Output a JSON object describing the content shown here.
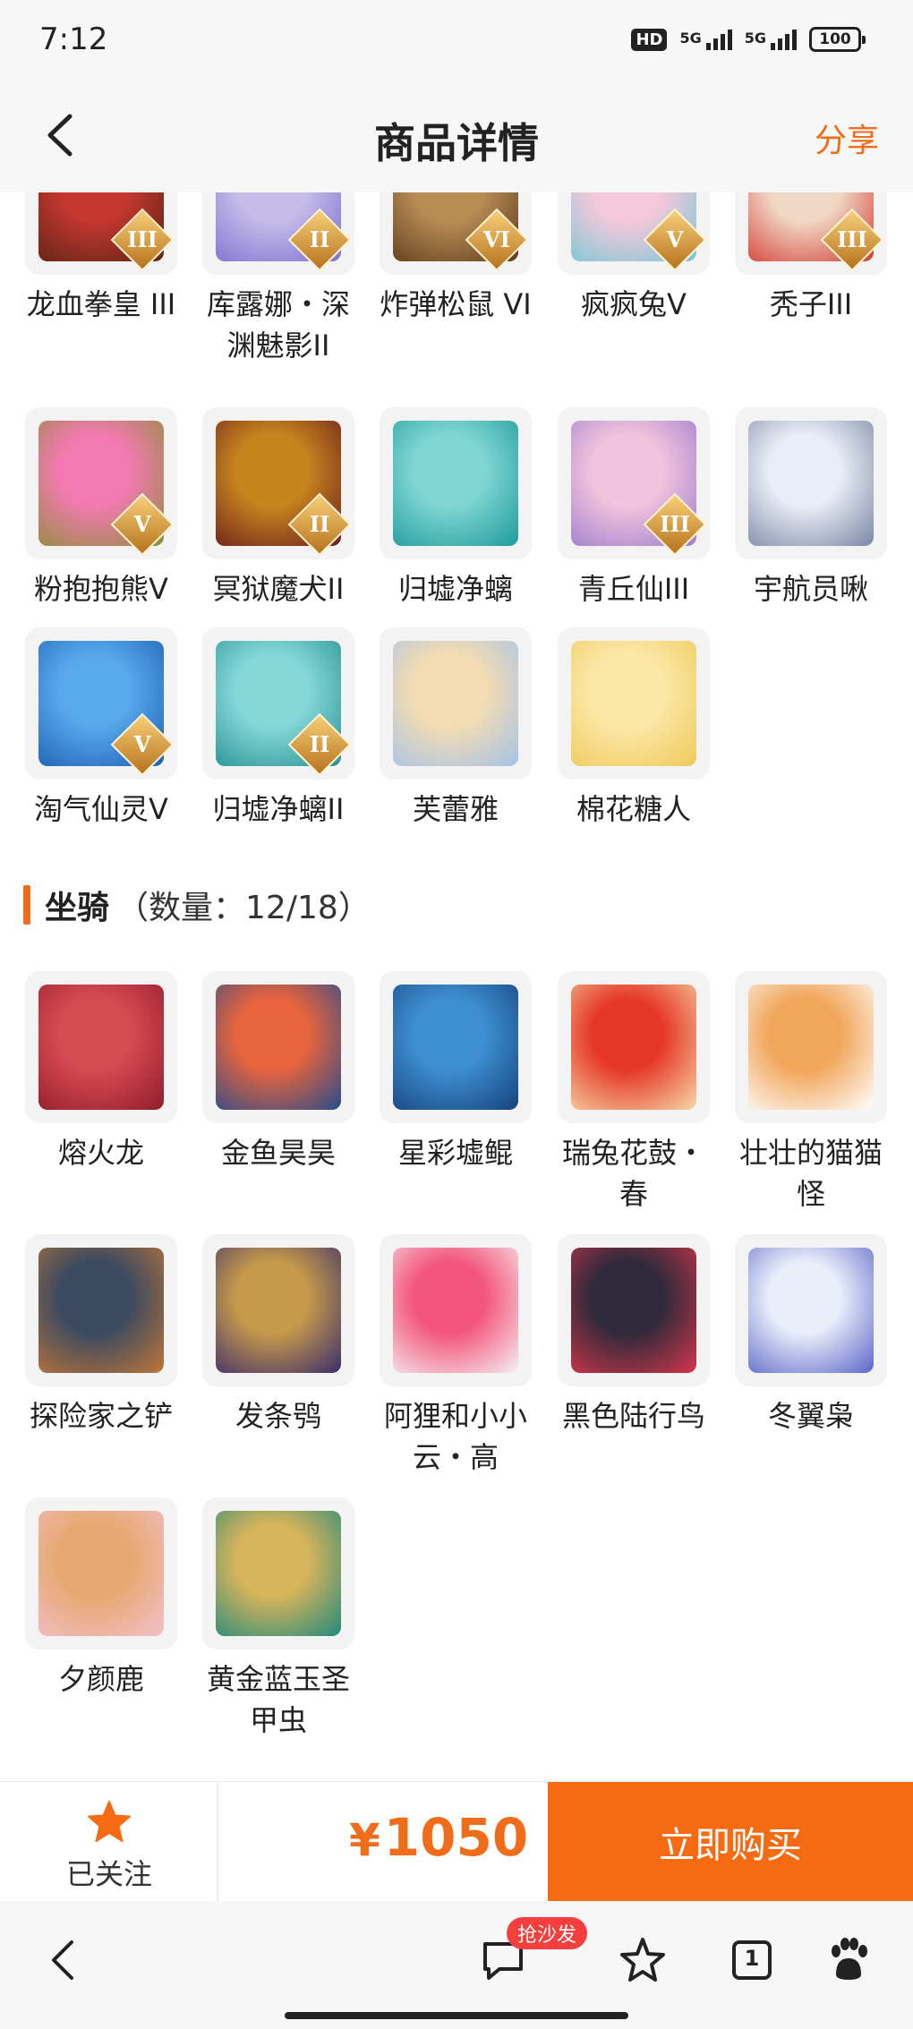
{
  "status_bar": {
    "time": "7:12",
    "hd_label": "HD",
    "network1": "5G",
    "network2": "5G",
    "battery": "100"
  },
  "nav": {
    "title": "商品详情",
    "share_label": "分享"
  },
  "skins": [
    {
      "name": "龙血拳皇 III",
      "level": "III",
      "colors": [
        "#c3372f",
        "#5a2414"
      ]
    },
    {
      "name": "库露娜・深渊魅影II",
      "level": "II",
      "colors": [
        "#c5bce8",
        "#7c6ed1"
      ]
    },
    {
      "name": "炸弹松鼠 VI",
      "level": "VI",
      "colors": [
        "#b98c55",
        "#5b3a1c"
      ]
    },
    {
      "name": "疯疯兔V",
      "level": "V",
      "colors": [
        "#f4c8d9",
        "#77c7d8"
      ]
    },
    {
      "name": "秃子III",
      "level": "III",
      "colors": [
        "#f0d7c4",
        "#d23a31"
      ]
    },
    {
      "name": "粉抱抱熊Ⅴ",
      "level": "V",
      "colors": [
        "#f27ab0",
        "#8f8e3a"
      ]
    },
    {
      "name": "冥狱魔犬II",
      "level": "II",
      "colors": [
        "#c7851e",
        "#6a1b1c"
      ]
    },
    {
      "name": "归墟净螭",
      "level": "",
      "colors": [
        "#7fd6d2",
        "#1e9a9c"
      ]
    },
    {
      "name": "青丘仙III",
      "level": "III",
      "colors": [
        "#f1c3dc",
        "#9b7ccf"
      ]
    },
    {
      "name": "宇航员啾",
      "level": "",
      "colors": [
        "#e9edf5",
        "#7b86a6"
      ]
    },
    {
      "name": "淘气仙灵V",
      "level": "V",
      "colors": [
        "#58a8ec",
        "#1a5fb3"
      ]
    },
    {
      "name": "归墟净螭II",
      "level": "II",
      "colors": [
        "#86d8d8",
        "#268f92"
      ]
    },
    {
      "name": "芙蕾雅",
      "level": "",
      "colors": [
        "#f4dcb2",
        "#a4c2e8"
      ]
    },
    {
      "name": "棉花糖人",
      "level": "",
      "colors": [
        "#fbe8a8",
        "#efc95a"
      ]
    }
  ],
  "mounts_section": {
    "title": "坐骑",
    "count": "（数量：12/18）"
  },
  "mounts": [
    {
      "name": "熔火龙",
      "colors": [
        "#d84a52",
        "#8f1d2c"
      ]
    },
    {
      "name": "金鱼昊昊",
      "colors": [
        "#e8643c",
        "#274c8c"
      ]
    },
    {
      "name": "星彩墟鲲",
      "colors": [
        "#3d8fd0",
        "#16427f"
      ]
    },
    {
      "name": "瑞兔花鼓・春",
      "colors": [
        "#e53828",
        "#f6d9a8"
      ]
    },
    {
      "name": "壮壮的猫猫怪",
      "colors": [
        "#f1a65a",
        "#ffffff"
      ]
    },
    {
      "name": "探险家之铲",
      "colors": [
        "#3b4a5f",
        "#c0763a"
      ]
    },
    {
      "name": "发条鸮",
      "colors": [
        "#c69a4a",
        "#3a2d6b"
      ]
    },
    {
      "name": "阿狸和小小云・高",
      "colors": [
        "#f3567a",
        "#f5f0f5"
      ]
    },
    {
      "name": "黑色陆行鸟",
      "colors": [
        "#2e2a3a",
        "#d6364c"
      ]
    },
    {
      "name": "冬翼枭",
      "colors": [
        "#e9eef9",
        "#5b66c8"
      ]
    },
    {
      "name": "夕颜鹿",
      "colors": [
        "#e6a870",
        "#f2c0c9"
      ]
    },
    {
      "name": "黄金蓝玉圣甲虫",
      "colors": [
        "#d8b45a",
        "#1f8a7c"
      ]
    }
  ],
  "purchase": {
    "follow_label": "已关注",
    "currency": "¥",
    "price": "1050",
    "buy_label": "立即购买"
  },
  "browser": {
    "badge_label": "抢沙发",
    "tab_count": "1"
  },
  "accent_color": "#ef6c1a"
}
